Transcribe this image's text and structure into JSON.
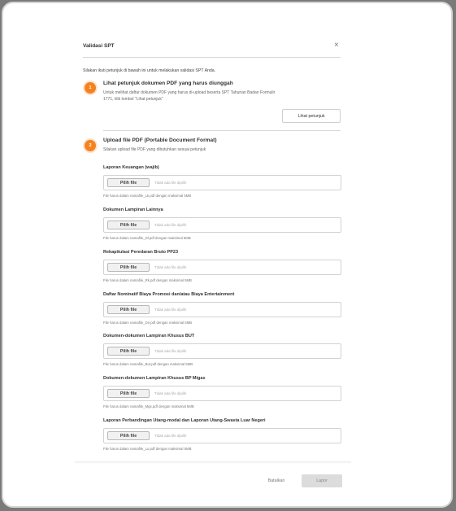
{
  "dialog": {
    "title": "Validasi SPT",
    "close_icon": "×",
    "intro": "Silakan ikuti petunjuk di bawah ini untuk melakukan validasi SPT Anda."
  },
  "steps": [
    {
      "number": "1",
      "title": "Lihat petunjuk dokumen PDF yang harus diunggah",
      "description_line1": "Untuk melihat daftar dokumen PDF yang harus di-upload beserta SPT Tahunan Badan Formulir",
      "description_line2": "1771, klik tombol \"Lihat petunjuk\"",
      "button_label": "Lihat petunjuk"
    },
    {
      "number": "2",
      "title": "Upload file PDF (Portable Document Format)",
      "description": "Silakan upload file PDF yang dibutuhkan sesuai petunjuk"
    }
  ],
  "file_fields": [
    {
      "label": "Laporan Keuangan (wajib)",
      "button": "Pilih file",
      "placeholder": "Tidak ada file dipilih",
      "hint": "File harus dalam namafile_Lk.pdf dengan maksimal 5MB"
    },
    {
      "label": "Dokumen Lampiran Lainnya",
      "button": "Pilih file",
      "placeholder": "Tidak ada file dipilih",
      "hint": "File harus dalam namafile_Dl.pdf dengan maksimal 5MB"
    },
    {
      "label": "Rekapitulasi Peredaran Bruto PP23",
      "button": "Pilih file",
      "placeholder": "Tidak ada file dipilih",
      "hint": "File harus dalam namafile_Rk.pdf dengan maksimal 5MB"
    },
    {
      "label": "Daftar Nominatif Biaya Promosi dan/atau Biaya Entertainment",
      "button": "Pilih file",
      "placeholder": "Tidak ada file dipilih",
      "hint": "File harus dalam namafile_Dn.pdf dengan maksimal 5MB"
    },
    {
      "label": "Dokumen-dokumen Lampiran Khusus BUT",
      "button": "Pilih file",
      "placeholder": "Tidak ada file dipilih",
      "hint": "File harus dalam namafile_But.pdf dengan maksimal 5MB"
    },
    {
      "label": "Dokumen-dokumen Lampiran Khusus BP Migas",
      "button": "Pilih file",
      "placeholder": "Tidak ada file dipilih",
      "hint": "File harus dalam namafile_Mgs.pdf dengan maksimal 5MB"
    },
    {
      "label": "Laporan Perbandingan Utang-modal dan Laporan Utang-Swasta Luar Negeri",
      "button": "Pilih file",
      "placeholder": "Tidak ada file dipilih",
      "hint": "File harus dalam namafile_Lu.pdf dengan maksimal 5MB"
    }
  ],
  "footer": {
    "cancel_label": "Batalkan",
    "submit_label": "Lapor"
  },
  "colors": {
    "accent": "#f58220",
    "submit_disabled_bg": "#dcdcdc"
  }
}
